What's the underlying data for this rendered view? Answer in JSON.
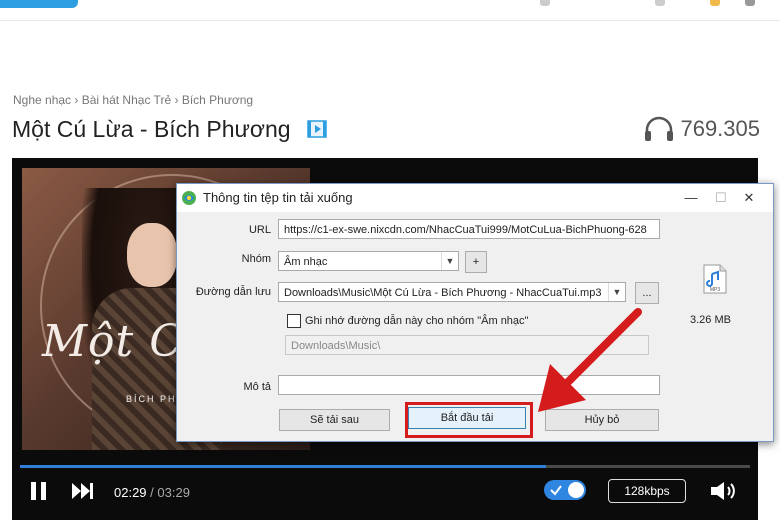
{
  "breadcrumb": [
    "Nghe nhạc",
    "Bài hát Nhạc Trẻ",
    "Bích Phương"
  ],
  "breadcrumb_sep": "›",
  "song": {
    "title": "Một Cú Lừa - Bích Phương",
    "listens": "769.305",
    "cover_text": "Một Cú",
    "cover_artist": "BÍCH PHƯƠ"
  },
  "player": {
    "current_time": "02:29",
    "separator": "/",
    "duration": "03:29",
    "progress_fraction": 0.72,
    "quality": "128kbps",
    "autoplay_on": true
  },
  "dialog": {
    "title": "Thông tin tệp tin tải xuống",
    "url_label": "URL",
    "url_value": "https://c1-ex-swe.nixcdn.com/NhacCuaTui999/MotCuLua-BichPhuong-628",
    "group_label": "Nhóm",
    "group_value": "Âm nhạc",
    "add_button": "+",
    "save_path_label": "Đường dẫn lưu",
    "save_path_value": "Downloads\\Music\\Một Cú Lừa - Bích Phương - NhacCuaTui.mp3",
    "browse_button": "...",
    "remember_label": "Ghi nhớ đường dẫn này cho nhóm \"Âm nhạc\"",
    "remember_checked": false,
    "remember_path": "Downloads\\Music\\",
    "desc_label": "Mô tả",
    "desc_value": "",
    "later_button": "Sẽ tải sau",
    "start_button": "Bắt đầu tải",
    "cancel_button": "Hủy bỏ",
    "file_size": "3.26 MB",
    "file_type_icon": "mp3-file-icon",
    "min_glyph": "—",
    "max_glyph": "☐",
    "close_glyph": "✕"
  },
  "colors": {
    "accent_blue": "#2d7fd8",
    "highlight_red": "#d51c1c",
    "dialog_border": "#7a9ac5"
  }
}
